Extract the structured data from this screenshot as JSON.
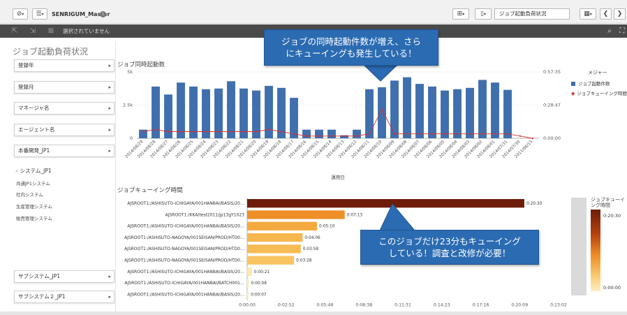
{
  "toolbar": {
    "nav_icon": "⊘",
    "list_icon": "☰",
    "app_title": "SENRIGUM_Master",
    "info_icon": "i",
    "sheet_selector": "ジョブ起動負荷状況"
  },
  "selection_bar": {
    "label": "選択されていません"
  },
  "sheet_title": "ジョブ起動負荷状況",
  "filters": [
    {
      "label": "登録年"
    },
    {
      "label": "登録月"
    },
    {
      "label": "マネージャ名"
    },
    {
      "label": "エージェント名"
    },
    {
      "label": "本番開発_JP1"
    }
  ],
  "system_list": {
    "header": "システム_JP1",
    "items": [
      "共通JP1システム",
      "社内システム",
      "生産管理システム",
      "販売管理システム"
    ]
  },
  "bottom_filters": [
    {
      "label": "サブシステム_JP1"
    },
    {
      "label": "サブシステム２_JP1"
    }
  ],
  "callouts": {
    "top": [
      "ジョブの同時起動件数が増え、さら",
      "にキューイングも発生している！"
    ],
    "bottom": [
      "このジョブだけ23分もキューイング",
      "している！調査と改修が必要！"
    ]
  },
  "chart_data": [
    {
      "type": "bar",
      "title": "ジョブ同時起動数",
      "xlabel": "運用日",
      "categories": [
        "2014/08/29",
        "2014/08/28",
        "2014/08/27",
        "2014/08/26",
        "2014/08/25",
        "2014/08/24",
        "2014/08/23",
        "2014/08/22",
        "2014/08/21",
        "2014/08/20",
        "2014/08/19",
        "2014/08/18",
        "2014/08/17",
        "2014/08/16",
        "2014/08/15",
        "2014/08/14",
        "2014/08/13",
        "2014/08/12",
        "2014/08/11",
        "2014/08/10",
        "2014/08/09",
        "2014/08/08",
        "2014/08/07",
        "2014/08/06",
        "2014/08/05",
        "2014/08/04",
        "2014/08/03",
        "2014/08/02",
        "2014/08/01",
        "2014/07/31",
        "2014/07/30",
        "2011/06/15"
      ],
      "y_left_ticks": [
        "0",
        "2.5k",
        "5k"
      ],
      "y_right_ticks": [
        "0:00:00",
        "0:28:47",
        "0:57:35"
      ],
      "ylim": [
        0,
        5000
      ],
      "legend_title": "メジャー",
      "series": [
        {
          "name": "ジョブ起動件数",
          "color": "#3f6fad",
          "type": "bar",
          "values": [
            650,
            3900,
            3300,
            4200,
            3900,
            3700,
            3750,
            4300,
            3750,
            3600,
            3950,
            3800,
            3050,
            650,
            650,
            650,
            230,
            650,
            3700,
            3850,
            4350,
            4600,
            4100,
            3900,
            3600,
            3700,
            3800,
            4400,
            4200,
            3650,
            0,
            0
          ]
        },
        {
          "name": "ジョブキューイング時間",
          "color": "#d8302f",
          "type": "line",
          "values": [
            0.3,
            0.4,
            0.3,
            0.3,
            0.3,
            0.3,
            0.3,
            0.3,
            0.3,
            0.3,
            0.4,
            0.3,
            0.2,
            0.1,
            0.1,
            0.1,
            0.1,
            0.1,
            0.2,
            1.3,
            0.2,
            0.2,
            0.2,
            0.2,
            0.2,
            0.2,
            0.2,
            0.2,
            0.2,
            0.2,
            0.1,
            0.0
          ]
        }
      ]
    },
    {
      "type": "bar",
      "orientation": "horizontal",
      "title": "ジョブキューイング時間",
      "legend_title": "ジョブキューイング時間",
      "legend_max": "0:20:30",
      "legend_min": "0:00:00",
      "x_ticks": [
        "0:00:00",
        "0:02:52",
        "0:05:46",
        "0:08:38",
        "0:11:31",
        "0:14:23",
        "0:17:16",
        "0:20:09",
        "0:23:02"
      ],
      "xlim_seconds": [
        0,
        1382
      ],
      "categories": [
        "AJSROOT1:/ASHISUTO-ICHIGAYA/001HANBAI/BASIS/20…",
        "AJSROOT1:/KKA/test2011/jp13gY1023",
        "AJSROOT1:/ASHISUTO-ICHIGAYA/001HANBAI/BASIS/20…",
        "AJSROOT1:/ASHISUTO-NAGOYA/001SEISAN/PROD/HTD0…",
        "AJSROOT1:/ASHISUTO-NAGOYA/001SEISAN/PROD/HTD0…",
        "AJSROOT1:/ASHISUTO-NAGOYA/001SEISAN/PROD/HTD0…",
        "AJSROOT1:/ASHISUTO-ICHIGAYA/001HANBAI/BASIS/20…",
        "AJSROOT1:/ASHISUTO-ICHIGAYA/001HANBAI/BATCH001…",
        "AJSROOT1:/ASHISUTO-ICHIGAYA/001HANBAI/BASIS/20…"
      ],
      "value_labels": [
        "0:20:30",
        "0:07:13",
        "0:05:10",
        "0:04:06",
        "0:03:58",
        "0:03:28",
        "0:00:21",
        "0:00:08",
        "0:00:07"
      ],
      "values_seconds": [
        1230,
        433,
        310,
        246,
        238,
        208,
        21,
        8,
        7
      ]
    }
  ]
}
